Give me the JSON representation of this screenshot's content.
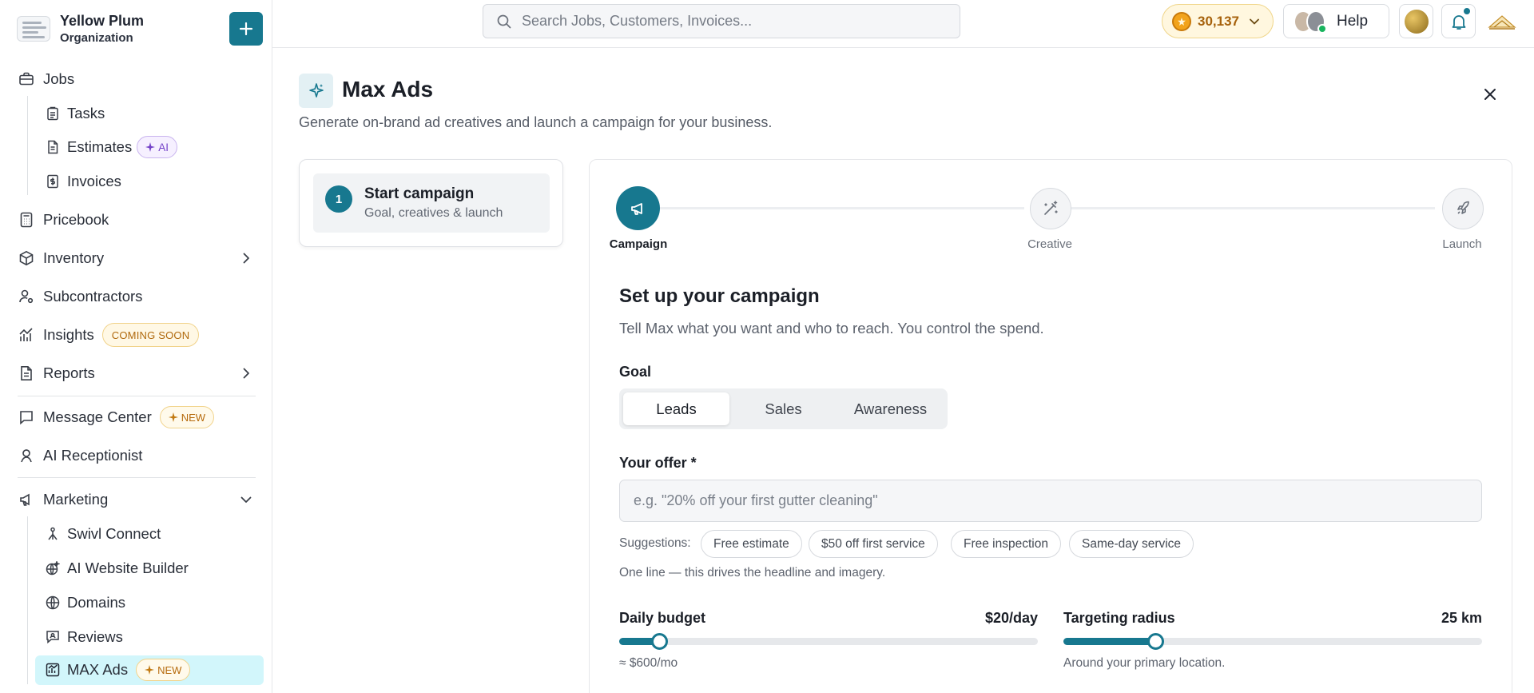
{
  "org": {
    "name": "Yellow Plum",
    "subtitle": "Organization"
  },
  "sidebar": {
    "jobs": "Jobs",
    "tasks": "Tasks",
    "estimates": "Estimates",
    "estimates_badge": "AI",
    "invoices": "Invoices",
    "pricebook": "Pricebook",
    "inventory": "Inventory",
    "subcontractors": "Subcontractors",
    "insights": "Insights",
    "insights_badge": "COMING SOON",
    "reports": "Reports",
    "message_center": "Message Center",
    "message_center_badge": "NEW",
    "ai_receptionist": "AI Receptionist",
    "marketing": "Marketing",
    "swivl_connect": "Swivl Connect",
    "ai_website_builder": "AI Website Builder",
    "domains": "Domains",
    "reviews": "Reviews",
    "max_ads": "MAX Ads",
    "max_ads_badge": "NEW"
  },
  "topbar": {
    "search_placeholder": "Search Jobs, Customers, Invoices...",
    "credits": "30,137",
    "help": "Help"
  },
  "page": {
    "title": "Max Ads",
    "subtitle": "Generate on-brand ad creatives and launch a campaign for your business."
  },
  "steps_panel": {
    "number": "1",
    "title": "Start campaign",
    "description": "Goal, creatives & launch"
  },
  "stepper": {
    "steps": [
      "Campaign",
      "Creative",
      "Launch"
    ],
    "active_index": 0
  },
  "form": {
    "title": "Set up your campaign",
    "subtitle": "Tell Max what you want and who to reach. You control the spend.",
    "goal_label": "Goal",
    "goal_options": [
      "Leads",
      "Sales",
      "Awareness"
    ],
    "goal_selected": "Leads",
    "offer_label": "Your offer *",
    "offer_placeholder": "e.g. \"20% off your first gutter cleaning\"",
    "offer_value": "",
    "suggestions_label": "Suggestions:",
    "suggestions": [
      "Free estimate",
      "$50 off first service",
      "Free inspection",
      "Same-day service"
    ],
    "offer_hint": "One line — this drives the headline and imagery.",
    "budget_label": "Daily budget",
    "budget_value": "$20/day",
    "budget_fraction": 0.095,
    "budget_monthly": "≈ $600/mo",
    "radius_label": "Targeting radius",
    "radius_value": "25 km",
    "radius_fraction": 0.22,
    "radius_hint": "Around your primary location."
  },
  "colors": {
    "accent": "#17788f",
    "active_nav": "#d2f6fb"
  }
}
